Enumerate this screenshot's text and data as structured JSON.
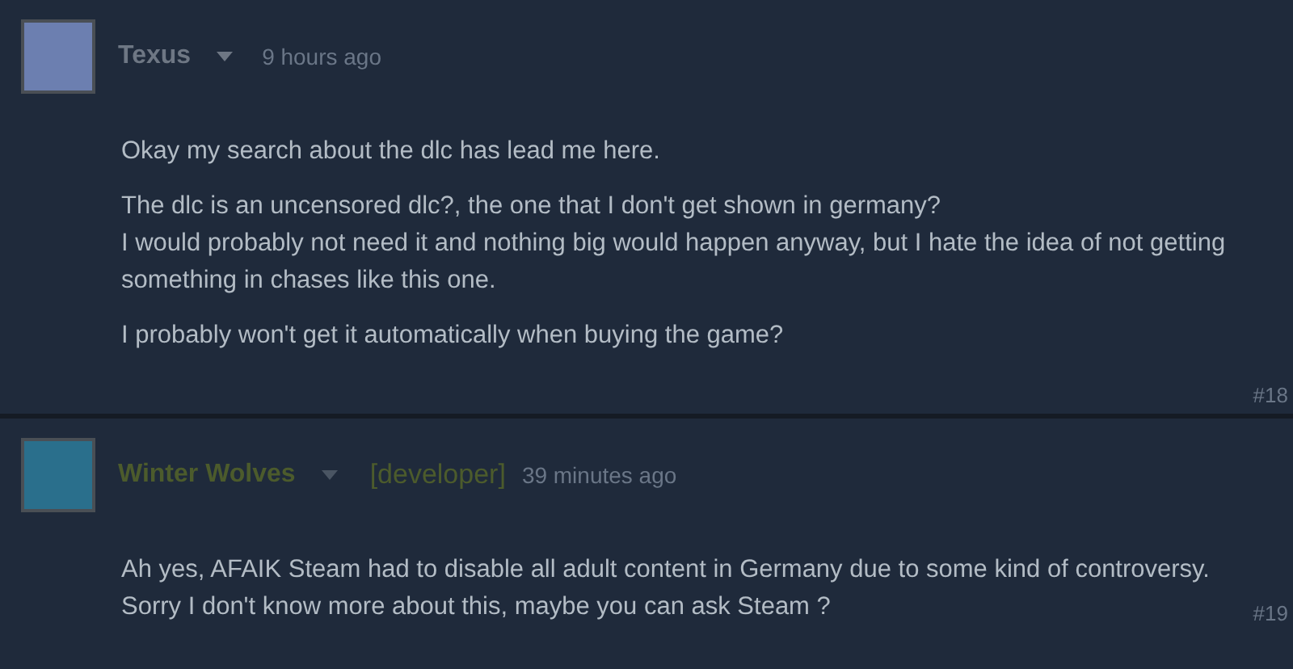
{
  "comments": [
    {
      "kind": "user",
      "author": "Texus",
      "time": "9 hours ago",
      "paragraphs": [
        "Okay my search about the dlc has lead me here.",
        "The dlc is an uncensored dlc?, the one that I don't get shown in germany?\nI would probably not need it and nothing big would happen anyway, but I hate the idea of not getting something in chases like this one.",
        "I probably won't get it automatically when buying the game?"
      ],
      "number": "#18"
    },
    {
      "kind": "developer",
      "author": "Winter Wolves",
      "badge": "[developer]",
      "time": "39 minutes ago",
      "paragraphs": [
        "Ah yes, AFAIK Steam had to disable all adult content in Germany due to some kind of controversy. Sorry I don't know more about this, maybe you can ask Steam ?"
      ],
      "number": "#19"
    }
  ]
}
